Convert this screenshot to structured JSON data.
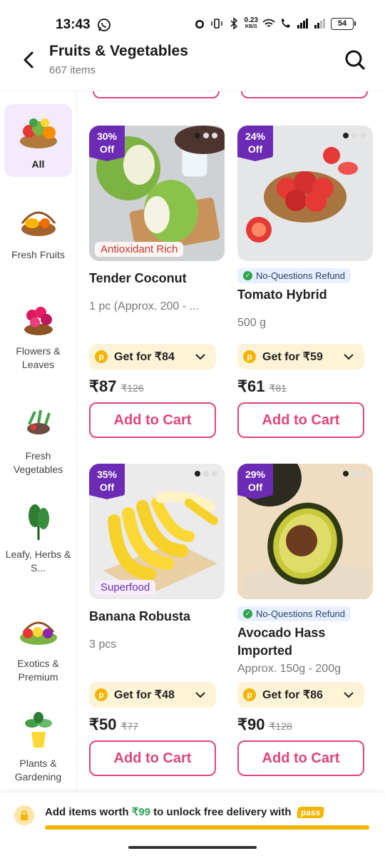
{
  "status": {
    "time": "13:43",
    "net_rate_top": "0.23",
    "net_rate_bottom": "KB/S",
    "battery": "54"
  },
  "header": {
    "title": "Fruits & Vegetables",
    "subtitle": "667 items"
  },
  "sidebar": {
    "items": [
      {
        "label": "All",
        "active": true
      },
      {
        "label": "Fresh Fruits"
      },
      {
        "label": "Flowers & Leaves"
      },
      {
        "label": "Fresh Vegetables"
      },
      {
        "label": "Leafy, Herbs & S..."
      },
      {
        "label": "Exotics & Premium"
      },
      {
        "label": "Plants & Gardening"
      }
    ]
  },
  "products": [
    {
      "discount_line1": "30%",
      "discount_line2": "Off",
      "tag": "Antioxidant Rich",
      "name": "Tender Coconut",
      "qty": "1 pc (Approx. 200 - ...",
      "pass_offer": "Get for ₹84",
      "price": "₹87",
      "mrp": "₹126",
      "cta": "Add to Cart"
    },
    {
      "discount_line1": "24%",
      "discount_line2": "Off",
      "badge": "No-Questions Refund",
      "name": "Tomato Hybrid",
      "qty": "500 g",
      "pass_offer": "Get for ₹59",
      "price": "₹61",
      "mrp": "₹81",
      "cta": "Add to Cart"
    },
    {
      "discount_line1": "35%",
      "discount_line2": "Off",
      "tag": "Superfood",
      "name": "Banana Robusta",
      "qty": "3 pcs",
      "pass_offer": "Get for ₹48",
      "price": "₹50",
      "mrp": "₹77",
      "cta": "Add to Cart"
    },
    {
      "discount_line1": "29%",
      "discount_line2": "Off",
      "badge": "No-Questions Refund",
      "name": "Avocado Hass Imported",
      "qty": "Approx. 150g - 200g",
      "pass_offer": "Get for ₹86",
      "price": "₹90",
      "mrp": "₹128",
      "cta": "Add to Cart"
    }
  ],
  "footer": {
    "text_before": "Add items worth",
    "amount": "₹99",
    "text_after": "to unlock free delivery with",
    "pass_logo": "pass",
    "progress_fraction": 1.0
  },
  "colors": {
    "accent": "#e0457b",
    "discount": "#6c2bb5",
    "pass": "#f4b400",
    "refund_bg": "#e6f0ff"
  }
}
